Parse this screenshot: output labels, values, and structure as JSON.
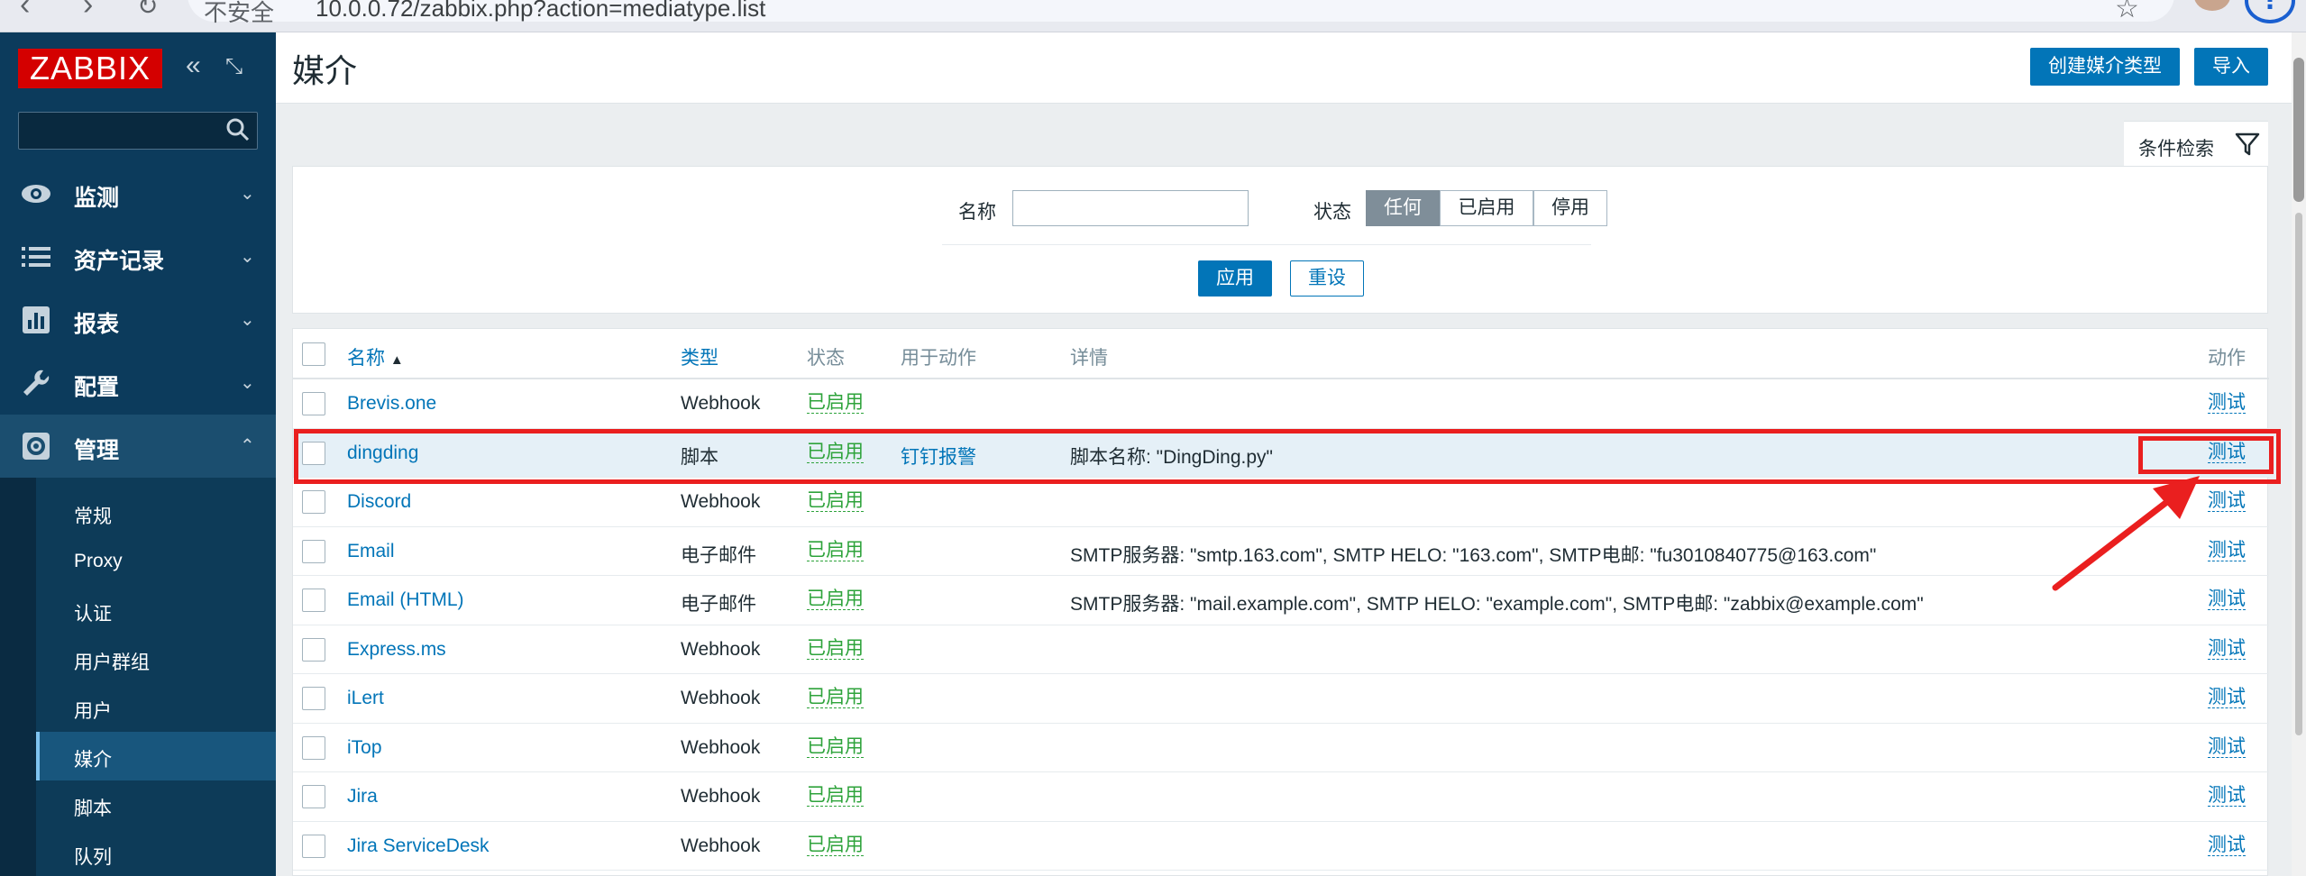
{
  "browser": {
    "site_label": "不安全",
    "url": "10.0.0.72/zabbix.php?action=mediatype.list"
  },
  "sidebar": {
    "logo": "ZABBIX",
    "search_value": "",
    "nav": [
      {
        "label": "监测",
        "icon": "eye-icon",
        "expanded": false
      },
      {
        "label": "资产记录",
        "icon": "list-icon",
        "expanded": false
      },
      {
        "label": "报表",
        "icon": "report-icon",
        "expanded": false
      },
      {
        "label": "配置",
        "icon": "wrench-icon",
        "expanded": false
      },
      {
        "label": "管理",
        "icon": "gear-icon",
        "expanded": true
      }
    ],
    "admin_items": [
      "常规",
      "Proxy",
      "认证",
      "用户群组",
      "用户",
      "媒介",
      "脚本",
      "队列"
    ],
    "active_item": "媒介"
  },
  "header": {
    "title": "媒介",
    "create_button": "创建媒介类型",
    "import_button": "导入"
  },
  "filter": {
    "tab_label": "条件检索",
    "name_label": "名称",
    "name_value": "",
    "status_label": "状态",
    "status_options": [
      "任何",
      "已启用",
      "停用"
    ],
    "status_selected": "任何",
    "apply": "应用",
    "reset": "重设"
  },
  "table": {
    "columns": {
      "name": "名称",
      "sort_indicator": "▲",
      "type": "类型",
      "status": "状态",
      "used_in_actions": "用于动作",
      "details": "详情",
      "action": "动作"
    },
    "rows": [
      {
        "name": "Brevis.one",
        "type": "Webhook",
        "status": "已启用",
        "used_in": "",
        "details": "",
        "test": "测试"
      },
      {
        "name": "dingding",
        "type": "脚本",
        "status": "已启用",
        "used_in": "钉钉报警",
        "details": "脚本名称: \"DingDing.py\"",
        "test": "测试",
        "highlighted": true
      },
      {
        "name": "Discord",
        "type": "Webhook",
        "status": "已启用",
        "used_in": "",
        "details": "",
        "test": "测试"
      },
      {
        "name": "Email",
        "type": "电子邮件",
        "status": "已启用",
        "used_in": "",
        "details": "SMTP服务器: \"smtp.163.com\", SMTP HELO: \"163.com\", SMTP电邮: \"fu3010840775@163.com\"",
        "test": "测试"
      },
      {
        "name": "Email (HTML)",
        "type": "电子邮件",
        "status": "已启用",
        "used_in": "",
        "details": "SMTP服务器: \"mail.example.com\", SMTP HELO: \"example.com\", SMTP电邮: \"zabbix@example.com\"",
        "test": "测试"
      },
      {
        "name": "Express.ms",
        "type": "Webhook",
        "status": "已启用",
        "used_in": "",
        "details": "",
        "test": "测试"
      },
      {
        "name": "iLert",
        "type": "Webhook",
        "status": "已启用",
        "used_in": "",
        "details": "",
        "test": "测试"
      },
      {
        "name": "iTop",
        "type": "Webhook",
        "status": "已启用",
        "used_in": "",
        "details": "",
        "test": "测试"
      },
      {
        "name": "Jira",
        "type": "Webhook",
        "status": "已启用",
        "used_in": "",
        "details": "",
        "test": "测试"
      },
      {
        "name": "Jira ServiceDesk",
        "type": "Webhook",
        "status": "已启用",
        "used_in": "",
        "details": "",
        "test": "测试"
      }
    ]
  },
  "colors": {
    "sidebar_bg": "#0c3b5c",
    "accent": "#0275b8",
    "status_enabled": "#2ea33b",
    "annotation": "#ea1f1f"
  }
}
